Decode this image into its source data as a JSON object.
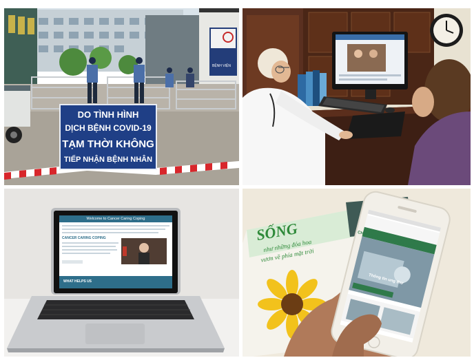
{
  "collage": {
    "panels": [
      {
        "id": "hospital-entrance",
        "sign_lines": [
          "DO TÌNH HÌNH",
          "DỊCH BỆNH COVID-19",
          "TẠM THỜI KHÔNG",
          "TIẾP NHẬN BỆNH NHÂN"
        ],
        "notice_board_lines": [
          "BỆNH VIỆN"
        ]
      },
      {
        "id": "doctor-telemedicine"
      },
      {
        "id": "laptop-website",
        "screen_header": "Welcome to Cancer Caring Coping",
        "screen_section_1": "CANCER CARING COPING",
        "screen_section_2": "WHAT HELPS US"
      },
      {
        "id": "phone-app",
        "app_header": "CHĂM SÓC BỆNH NHÂN UNG THƯ",
        "app_banner_text": "Thông tin ung thư",
        "book_title": "SỐNG",
        "book_subtitle_1": "như những đóa hoa",
        "book_subtitle_2": "vươn về phía mặt trời"
      }
    ]
  },
  "colors": {
    "sign_blue": "#1f3f86",
    "tape_red": "#d8262b",
    "app_green": "#2f7a4a"
  }
}
